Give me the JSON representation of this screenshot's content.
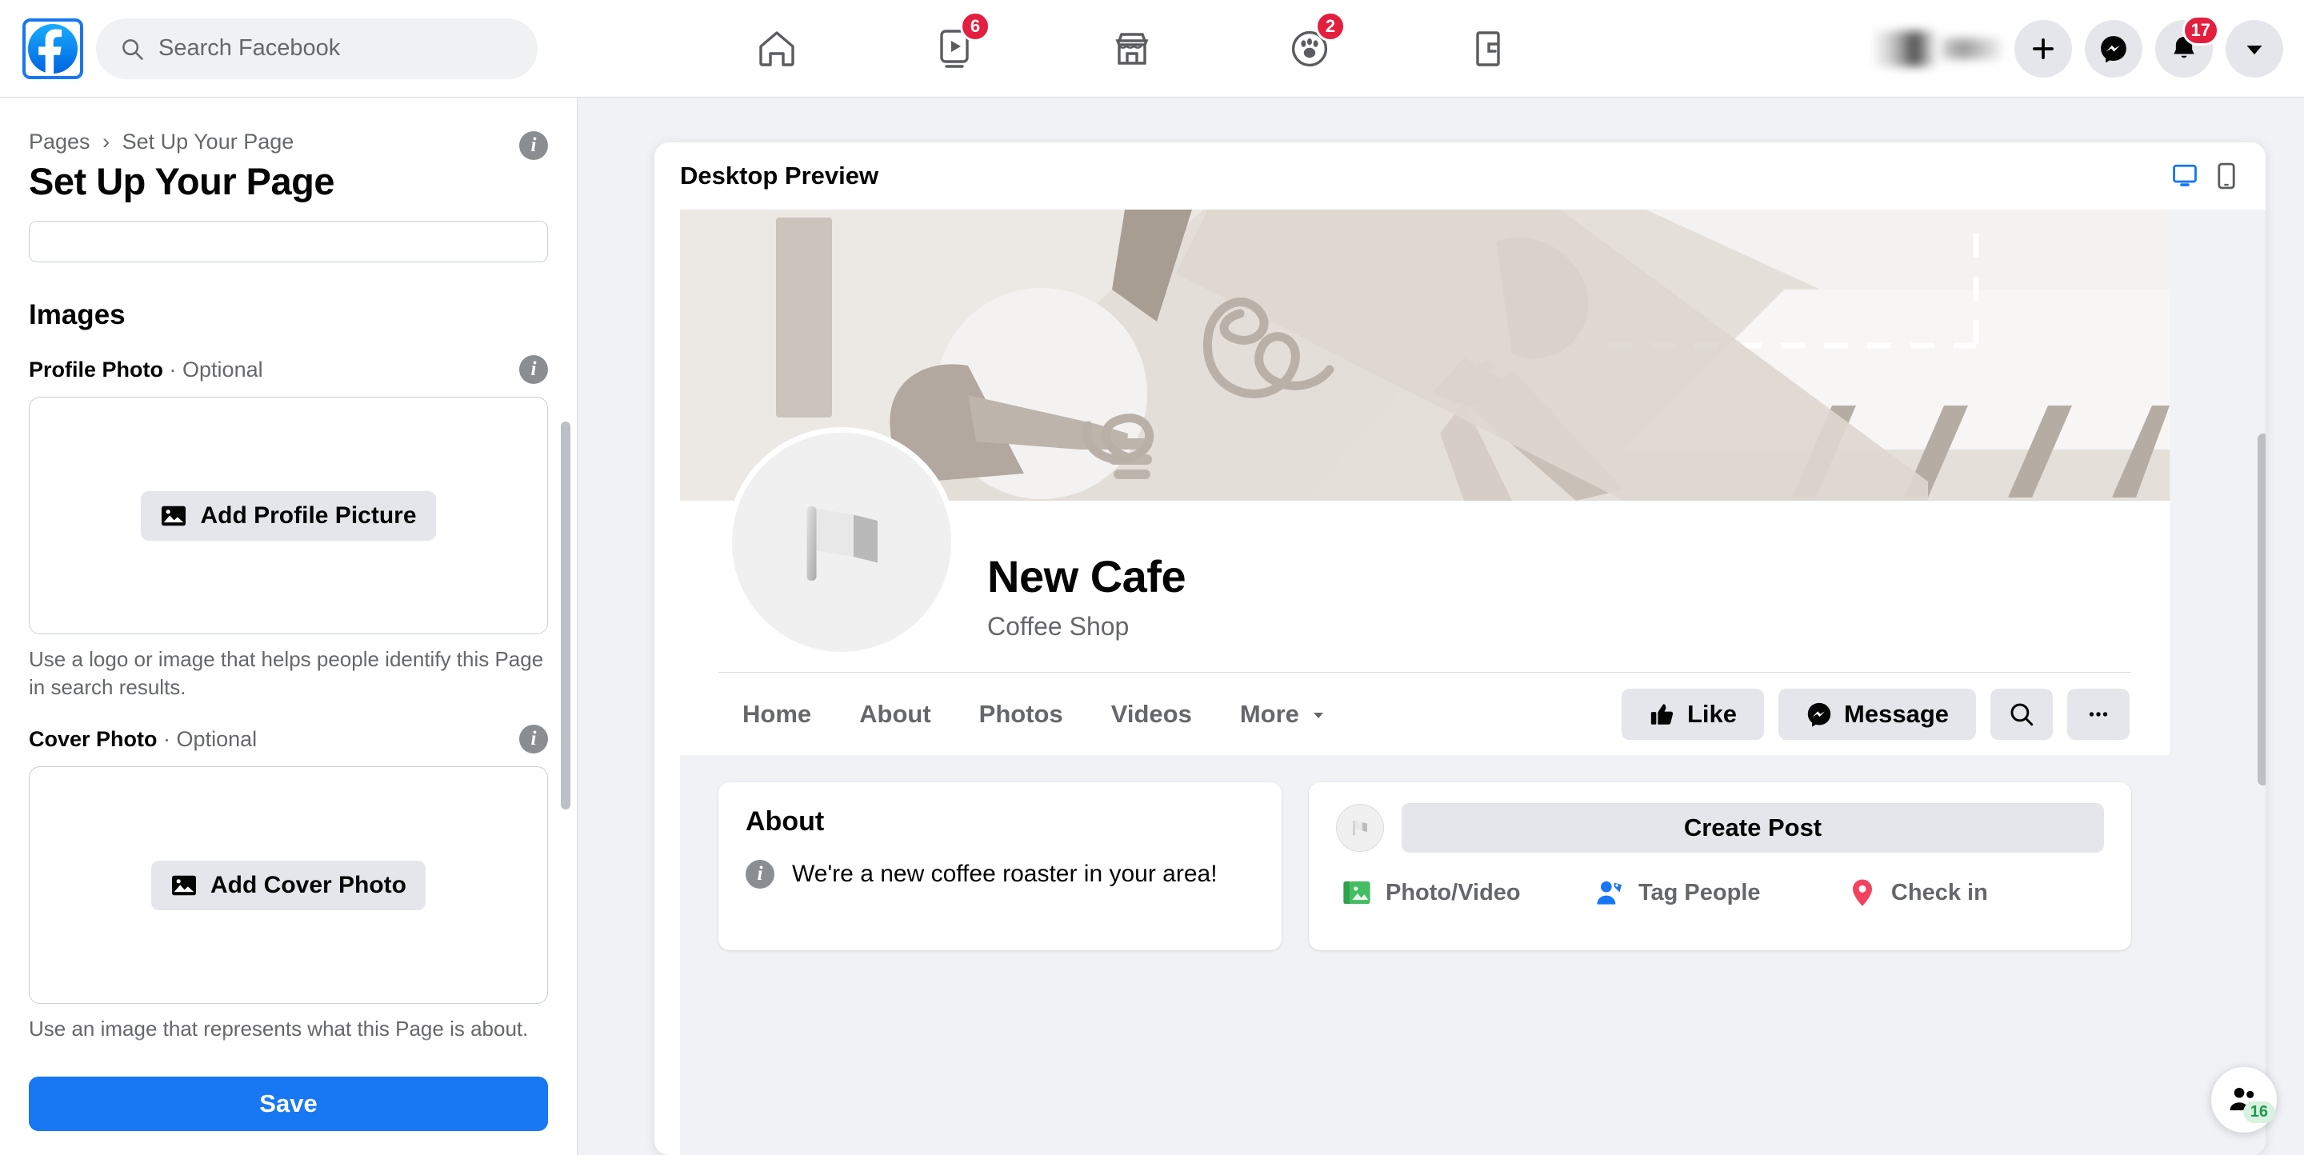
{
  "colors": {
    "brand_blue": "#1877f2",
    "badge_red": "#e41e3f",
    "button_gray": "#e4e6eb",
    "page_bg": "#f0f2f5",
    "text_primary": "#050505",
    "text_secondary": "#65676b",
    "green_photo": "#45bd62",
    "blue_tag": "#1877f2",
    "red_pin": "#f3425f",
    "badge_green_text": "#1d9a4c"
  },
  "topnav": {
    "logo_icon": "facebook-logo-icon",
    "search": {
      "placeholder": "Search Facebook",
      "icon": "search-icon"
    },
    "tabs": [
      {
        "name": "home",
        "icon": "home-icon",
        "badge": ""
      },
      {
        "name": "video",
        "icon": "video-play-icon",
        "badge": "6"
      },
      {
        "name": "marketplace",
        "icon": "marketplace-store-icon",
        "badge": ""
      },
      {
        "name": "groups",
        "icon": "groups-icon",
        "badge": "2"
      },
      {
        "name": "gaming",
        "icon": "gaming-icon",
        "badge": ""
      }
    ],
    "account_name_masked": "",
    "create": {
      "icon": "plus-icon",
      "label": ""
    },
    "messenger": {
      "icon": "messenger-icon",
      "label": ""
    },
    "notifications": {
      "icon": "bell-icon",
      "badge": "17"
    },
    "account_menu": {
      "icon": "chevron-down-icon"
    }
  },
  "sidebar": {
    "breadcrumb": {
      "root": "Pages",
      "separator": "›",
      "current": "Set Up Your Page"
    },
    "title": "Set Up Your Page",
    "title_info_icon": "info-icon",
    "name_field": {
      "value": "",
      "placeholder": ""
    },
    "images_section": "Images",
    "profile_photo": {
      "label": "Profile Photo",
      "optional": "Optional",
      "separator": "·",
      "info_icon": "info-icon",
      "button_label": "Add Profile Picture",
      "button_icon": "image-icon",
      "helper": "Use a logo or image that helps people identify this Page in search results."
    },
    "cover_photo": {
      "label": "Cover Photo",
      "optional": "Optional",
      "separator": "·",
      "info_icon": "info-icon",
      "button_label": "Add Cover Photo",
      "button_icon": "image-icon",
      "helper": "Use an image that represents what this Page is about."
    },
    "save_label": "Save"
  },
  "preview": {
    "header_title": "Desktop Preview",
    "device_desktop": {
      "icon": "desktop-icon",
      "active": true
    },
    "device_mobile": {
      "icon": "mobile-icon",
      "active": false
    },
    "page": {
      "avatar_icon": "flag-placeholder-icon",
      "name": "New Cafe",
      "category": "Coffee Shop",
      "tabs": [
        {
          "label": "Home"
        },
        {
          "label": "About"
        },
        {
          "label": "Photos"
        },
        {
          "label": "Videos"
        },
        {
          "label": "More",
          "icon": "chevron-down-icon"
        }
      ],
      "actions": {
        "like": {
          "label": "Like",
          "icon": "thumbs-up-icon"
        },
        "message": {
          "label": "Message",
          "icon": "messenger-icon"
        },
        "search": {
          "icon": "search-icon"
        },
        "more": {
          "icon": "ellipsis-icon"
        }
      },
      "about_card": {
        "title": "About",
        "info_icon": "info-icon",
        "text": "We're a new coffee roaster in your area!"
      },
      "post_card": {
        "avatar_icon": "flag-placeholder-icon",
        "create_post_label": "Create Post",
        "actions": [
          {
            "label": "Photo/Video",
            "icon": "photo-video-icon"
          },
          {
            "label": "Tag People",
            "icon": "tag-people-icon"
          },
          {
            "label": "Check in",
            "icon": "location-pin-icon"
          }
        ]
      }
    }
  },
  "contacts_fab": {
    "icon": "contacts-icon",
    "badge": "16"
  }
}
